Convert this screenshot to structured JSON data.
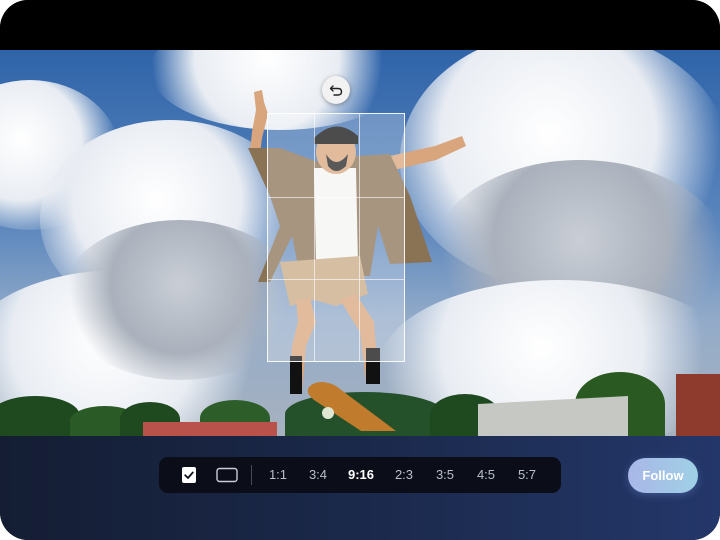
{
  "editor": {
    "undo_icon": "undo-arrow-icon",
    "ratio_toolbar": {
      "check_icon": "checkbox-check-icon",
      "frame_icon": "rectangle-frame-icon",
      "ratios": [
        "1:1",
        "3:4",
        "9:16",
        "2:3",
        "3:5",
        "4:5",
        "5:7"
      ],
      "selected": "9:16"
    },
    "follow_label": "Follow"
  },
  "colors": {
    "accent_gradient_start": "#a9b7e8",
    "accent_gradient_end": "#9fd0e5",
    "toolbar_bg": "#0b0e18",
    "bottom_panel": "#1b2a4d"
  }
}
